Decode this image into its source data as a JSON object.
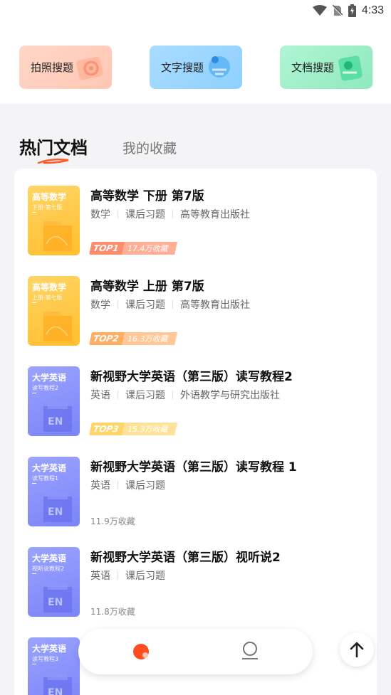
{
  "status_bar": {
    "time": "4:33"
  },
  "search_buttons": [
    {
      "label": "拍照搜题"
    },
    {
      "label": "文字搜题"
    },
    {
      "label": "文档搜题"
    }
  ],
  "tabs": {
    "active": "热门文档",
    "inactive": "我的收藏"
  },
  "documents": [
    {
      "cover_title": "高等数学",
      "cover_sub": "下册·第七版",
      "title": "高等数学 下册 第7版",
      "tags": [
        "数学",
        "课后习题",
        "高等教育出版社"
      ],
      "rank": "TOP1",
      "count": "17.4万收藏"
    },
    {
      "cover_title": "高等数学",
      "cover_sub": "上册·第七版",
      "title": "高等数学 上册 第7版",
      "tags": [
        "数学",
        "课后习题",
        "高等教育出版社"
      ],
      "rank": "TOP2",
      "count": "16.3万收藏"
    },
    {
      "cover_title": "大学英语",
      "cover_sub": "读写教程2",
      "title": "新视野大学英语（第三版）读写教程2",
      "tags": [
        "英语",
        "课后习题",
        "外语教学与研究出版社"
      ],
      "rank": "TOP3",
      "count": "15.3万收藏"
    },
    {
      "cover_title": "大学英语",
      "cover_sub": "读写教程1",
      "title": "新视野大学英语（第三版）读写教程 1",
      "tags": [
        "英语",
        "课后习题"
      ],
      "count": "11.9万收藏"
    },
    {
      "cover_title": "大学英语",
      "cover_sub": "视听说教程2",
      "title": "新视野大学英语（第三版）视听说2",
      "tags": [
        "英语",
        "课后习题"
      ],
      "count": "11.8万收藏"
    },
    {
      "cover_title": "大学英语",
      "cover_sub": "读写教程3"
    }
  ]
}
